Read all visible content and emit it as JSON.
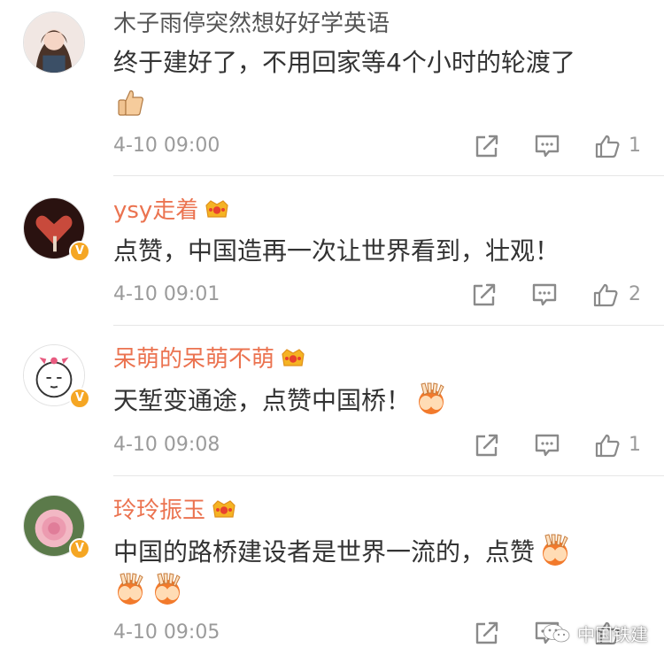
{
  "comments": [
    {
      "username": "木子雨停突然想好好学英语",
      "text": "终于建好了，不用回家等4个小时的轮渡了",
      "emoji": "thumbs-up-emoji",
      "timestamp": "4-10 09:00",
      "likes": "1",
      "vip": false
    },
    {
      "username": "ysy走着",
      "text": "点赞，中国造再一次让世界看到，壮观！",
      "timestamp": "4-10 09:01",
      "likes": "2",
      "vip": true
    },
    {
      "username": "呆萌的呆萌不萌",
      "text": "天堑变通途，点赞中国桥！",
      "emoji": "clap-hands-emoji",
      "timestamp": "4-10 09:08",
      "likes": "1",
      "vip": true
    },
    {
      "username": "玲玲振玉",
      "text": "中国的路桥建设者是世界一流的，点赞",
      "emoji": "clap-hands-emoji",
      "timestamp": "4-10 09:05",
      "likes": "",
      "vip": true
    }
  ],
  "icons": {
    "share": "share-icon",
    "comment": "comment-icon",
    "like": "thumbs-up-icon",
    "crown": "crown-badge-icon",
    "verified": "verified-v-badge"
  },
  "colors": {
    "vip_name": "#eb7350",
    "plain_name": "#555555",
    "text": "#333333",
    "meta": "#9b9b9b",
    "badge": "#f5a623"
  },
  "watermark": {
    "text": "中国铁建"
  },
  "badge_glyph": "V"
}
